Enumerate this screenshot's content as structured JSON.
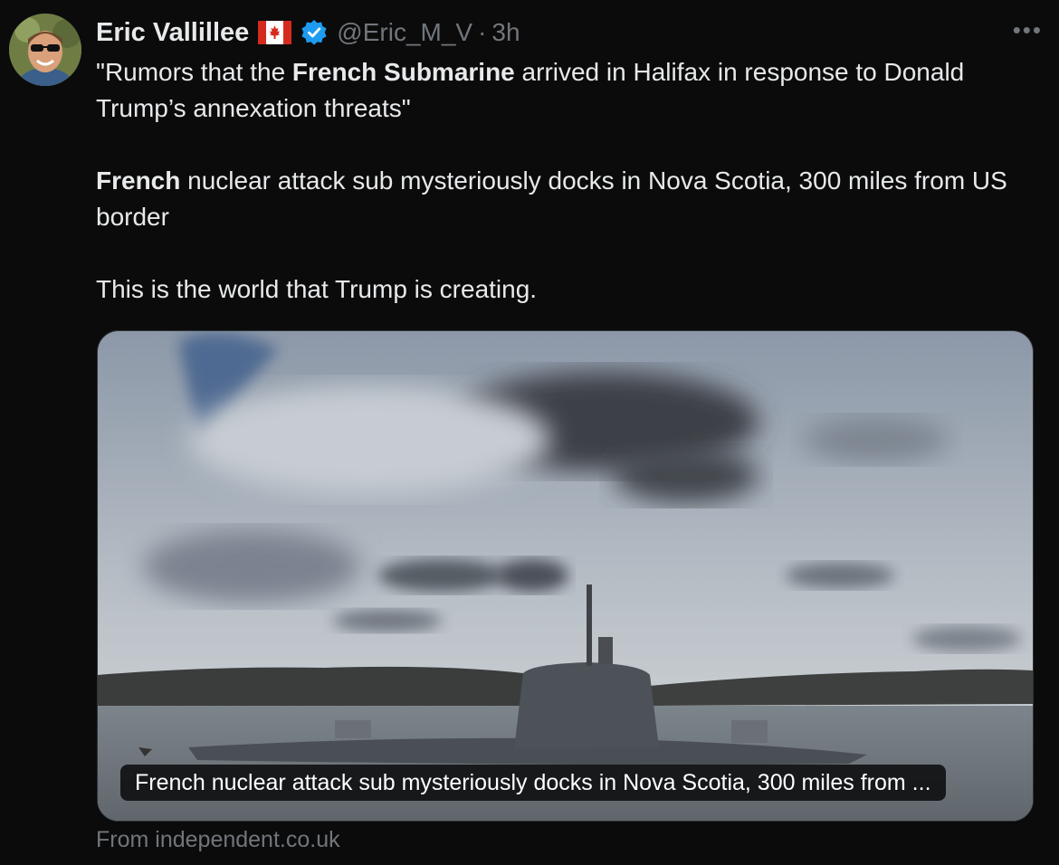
{
  "tweet": {
    "author_name": "Eric Vallillee",
    "handle": "@Eric_M_V",
    "separator": "·",
    "time": "3h",
    "more": "•••",
    "paragraphs": [
      {
        "segments": [
          {
            "text": "\"Rumors that the ",
            "bold": false
          },
          {
            "text": "French Submarine",
            "bold": true
          },
          {
            "text": " arrived in Halifax in response to Donald Trump’s annexation threats\"",
            "bold": false
          }
        ]
      },
      {
        "segments": [
          {
            "text": "French",
            "bold": true
          },
          {
            "text": " nuclear attack sub mysteriously docks in Nova Scotia, 300 miles from US border",
            "bold": false
          }
        ]
      },
      {
        "segments": [
          {
            "text": "This is the world that Trump is creating.",
            "bold": false
          }
        ]
      }
    ]
  },
  "card": {
    "caption": "French nuclear attack sub mysteriously docks in Nova Scotia, 300 miles from ...",
    "source": "From independent.co.uk"
  },
  "colors": {
    "background": "#0b0b0c",
    "text": "#e7e9ea",
    "muted": "#71767b",
    "verified": "#1d9bf0",
    "flag_red": "#d52b1e"
  },
  "icons": {
    "flag": "canada-flag-icon",
    "verified": "verified-badge-icon",
    "more": "more-options-icon"
  }
}
